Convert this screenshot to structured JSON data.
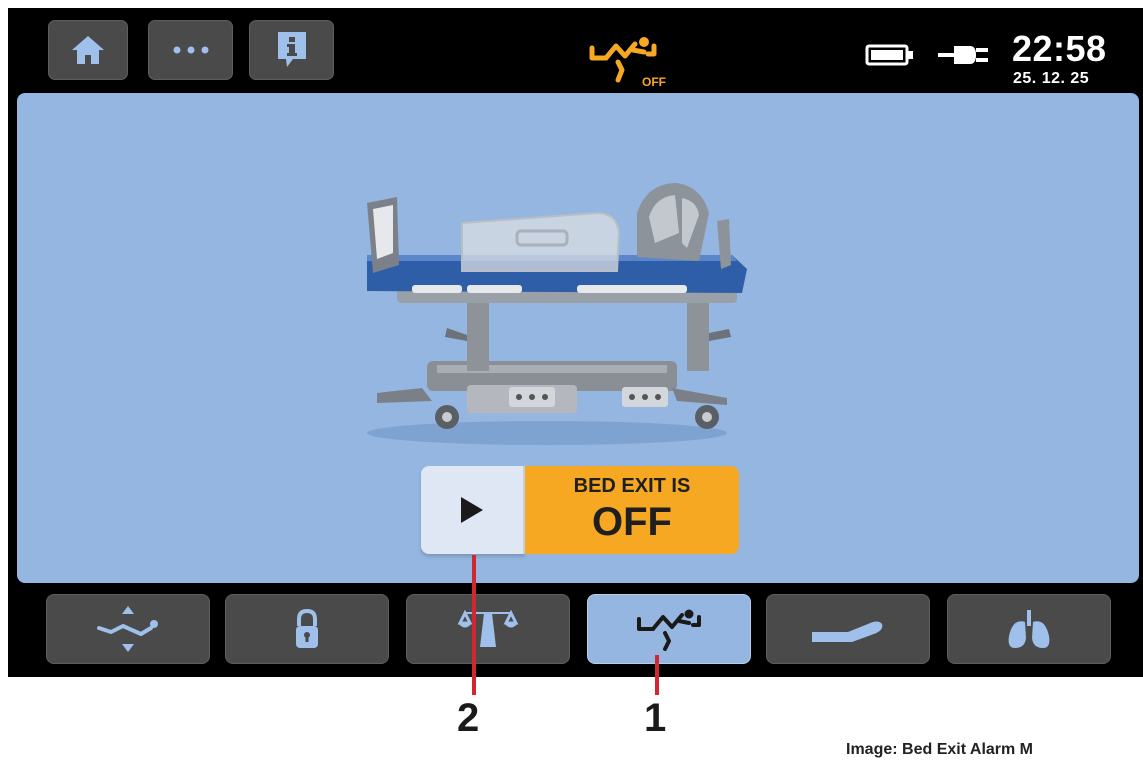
{
  "topbar": {
    "home_icon": "home-icon",
    "more_icon": "more-dots-icon",
    "info_icon": "info-icon",
    "bed_exit_status_icon": "bed-exit-icon",
    "bed_exit_status_label": "OFF",
    "battery_icon": "battery-icon",
    "mains_icon": "plug-icon",
    "time": "22:58",
    "date": "25. 12. 25"
  },
  "main": {
    "illustration": "hospital-bed-icon",
    "bed_exit": {
      "play_icon": "play-icon",
      "status_line1": "BED EXIT IS",
      "status_line2": "OFF",
      "status_color": "#f7a823"
    }
  },
  "bottom_nav": [
    {
      "icon": "bed-height-icon",
      "active": false
    },
    {
      "icon": "lock-icon",
      "active": false
    },
    {
      "icon": "scale-icon",
      "active": false
    },
    {
      "icon": "bed-exit-icon",
      "active": true
    },
    {
      "icon": "bed-position-icon",
      "active": false
    },
    {
      "icon": "lungs-icon",
      "active": false
    }
  ],
  "callouts": {
    "one": "1",
    "two": "2"
  },
  "caption": "Image: Bed Exit Alarm M"
}
